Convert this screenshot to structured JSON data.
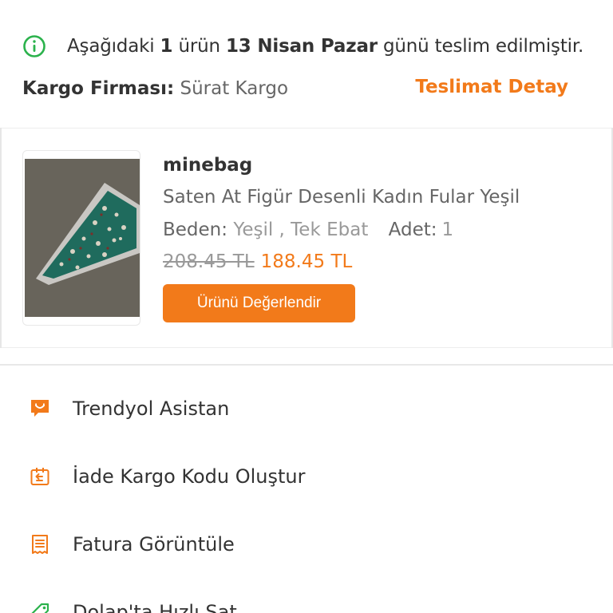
{
  "delivery_status": {
    "prefix": "Aşağıdaki ",
    "count": "1",
    "middle": " ürün ",
    "date": "13 Nisan Pazar",
    "suffix": " günü teslim edilmiştir.",
    "icon": "info-circle-icon"
  },
  "cargo": {
    "label": "Kargo Firması:",
    "value": " Sürat Kargo",
    "detail_link": "Teslimat Detay"
  },
  "product": {
    "seller": "minebag",
    "title": "Saten At Figür Desenli Kadın Fular Yeşil",
    "size_label": "Beden:",
    "size_value": " Yeşil , Tek Ebat",
    "qty_label": "Adet:",
    "qty_value": "1",
    "old_price": "208.45 TL",
    "new_price": "188.45 TL",
    "review_button": "Ürünü Değerlendir"
  },
  "menu": [
    {
      "label": "Trendyol Asistan",
      "icon": "chat-bubble-icon"
    },
    {
      "label": "İade Kargo Kodu Oluştur",
      "icon": "return-box-icon"
    },
    {
      "label": "Fatura Görüntüle",
      "icon": "invoice-icon"
    },
    {
      "label": "Dolap'ta Hızlı Sat",
      "icon": "tag-icon"
    }
  ],
  "colors": {
    "accent": "#f27a1a",
    "success": "#2bb24c",
    "text": "#333333",
    "muted": "#999999"
  }
}
